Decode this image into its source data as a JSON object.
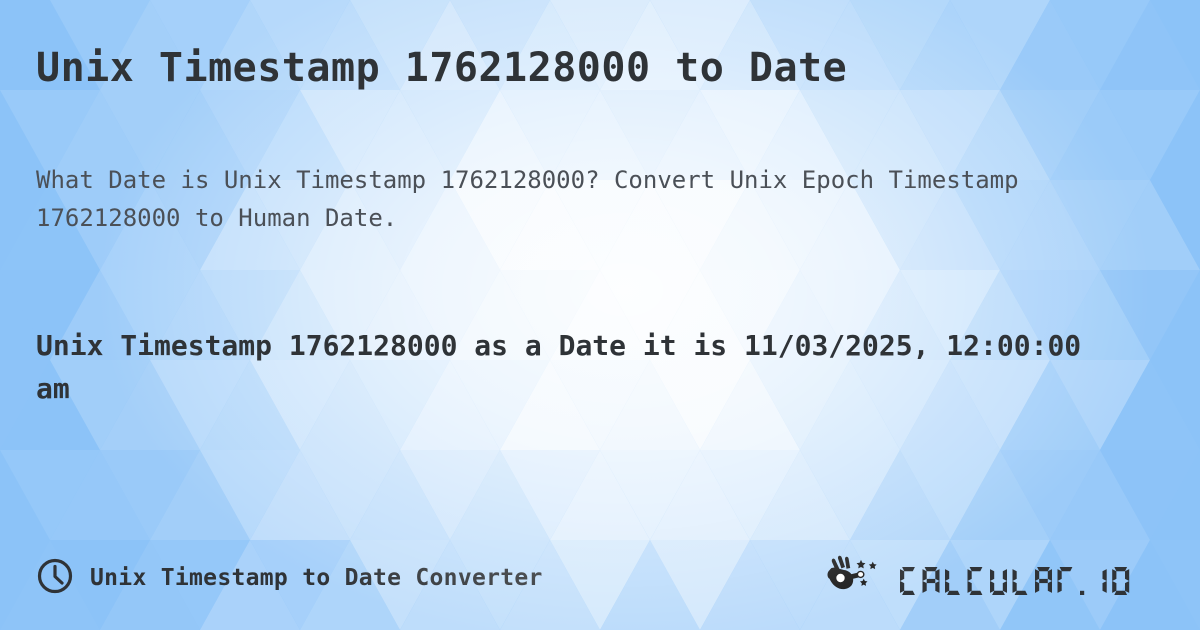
{
  "page": {
    "title": "Unix Timestamp 1762128000 to Date",
    "description": "What Date is Unix Timestamp 1762128000? Convert Unix Epoch Timestamp 1762128000 to Human Date.",
    "result": "Unix Timestamp 1762128000 as a Date it is 11/03/2025, 12:00:00 am",
    "timestamp": "1762128000",
    "human_date": "11/03/2025, 12:00:00 am"
  },
  "footer": {
    "clock_icon": "clock-icon",
    "label": "Unix Timestamp to Date Converter",
    "brand_icon": "magic-wand-hand-icon",
    "brand_name": "CALCULAT.IO"
  },
  "colors": {
    "background_blue": "#8cc3f8",
    "background_light": "#ffffff",
    "heading_text": "#2f3337",
    "body_text": "#4b5057"
  }
}
